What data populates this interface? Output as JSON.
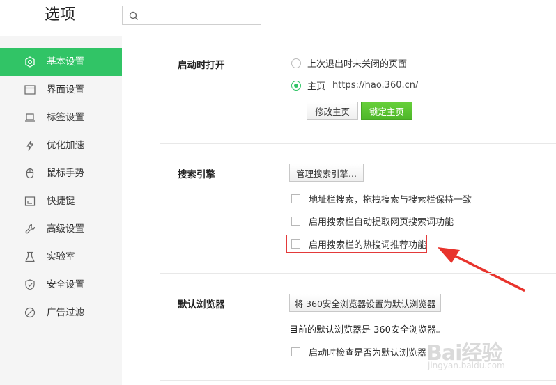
{
  "header": {
    "title": "选项",
    "search": {
      "value": "",
      "placeholder": ""
    }
  },
  "sidebar": {
    "items": [
      {
        "label": "基本设置",
        "icon": "hexagon-icon",
        "active": true
      },
      {
        "label": "界面设置",
        "icon": "window-icon",
        "active": false
      },
      {
        "label": "标签设置",
        "icon": "laptop-icon",
        "active": false
      },
      {
        "label": "优化加速",
        "icon": "lightning-icon",
        "active": false
      },
      {
        "label": "鼠标手势",
        "icon": "mouse-icon",
        "active": false
      },
      {
        "label": "快捷键",
        "icon": "shortcut-icon",
        "active": false
      },
      {
        "label": "高级设置",
        "icon": "wrench-icon",
        "active": false
      },
      {
        "label": "实验室",
        "icon": "flask-icon",
        "active": false
      },
      {
        "label": "安全设置",
        "icon": "shield-icon",
        "active": false
      },
      {
        "label": "广告过滤",
        "icon": "block-icon",
        "active": false
      }
    ]
  },
  "startup": {
    "title": "启动时打开",
    "option_last": "上次退出时未关闭的页面",
    "option_home": "主页",
    "home_url": "https://hao.360.cn/",
    "modify_button": "修改主页",
    "lock_button": "锁定主页"
  },
  "search_engine": {
    "title": "搜索引擎",
    "manage_button": "管理搜索引擎...",
    "check_sync": "地址栏搜索，拖拽搜索与搜索栏保持一致",
    "check_extract": "启用搜索栏自动提取网页搜索词功能",
    "check_hot": "启用搜索栏的热搜词推荐功能"
  },
  "default_browser": {
    "title": "默认浏览器",
    "set_button": "将 360安全浏览器设置为默认浏览器",
    "status": "目前的默认浏览器是 360安全浏览器。",
    "check_on_start": "启动时检查是否为默认浏览器"
  },
  "watermark": {
    "brand": "Bai经验",
    "url": "jingyan.baidu.com"
  },
  "colors": {
    "accent": "#31c466",
    "highlight": "#e33a3a",
    "sidebar_bg": "#f5f5f5"
  }
}
